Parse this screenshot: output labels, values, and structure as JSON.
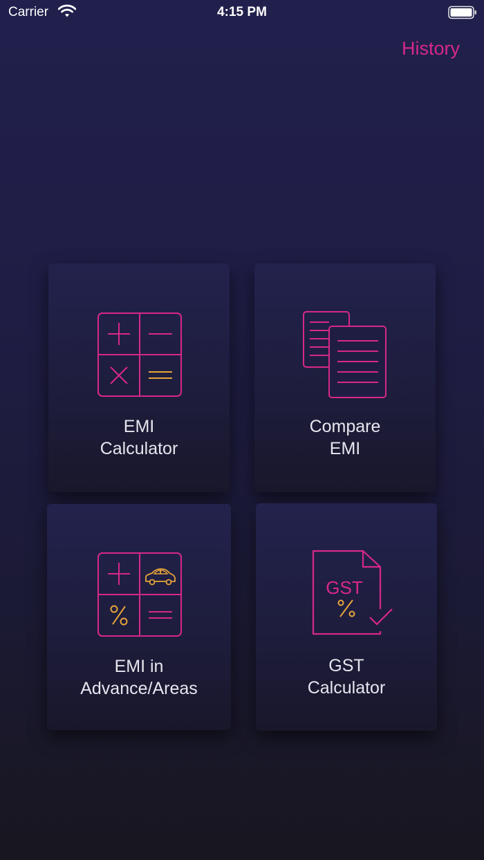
{
  "status_bar": {
    "carrier": "Carrier",
    "time": "4:15 PM",
    "wifi_icon": "wifi-icon",
    "battery_icon": "battery-icon"
  },
  "header": {
    "history_label": "History"
  },
  "colors": {
    "accent": "#d8288a",
    "secondary": "#e8a53a",
    "background": "#1f1d44"
  },
  "cards": [
    {
      "line1": "EMI",
      "line2": "Calculator",
      "icon": "calculator-icon"
    },
    {
      "line1": "Compare",
      "line2": "EMI",
      "icon": "documents-icon"
    },
    {
      "line1": "EMI in",
      "line2": "Advance/Areas",
      "icon": "calculator-car-icon"
    },
    {
      "line1": "GST",
      "line2": "Calculator",
      "icon": "gst-document-icon"
    }
  ]
}
